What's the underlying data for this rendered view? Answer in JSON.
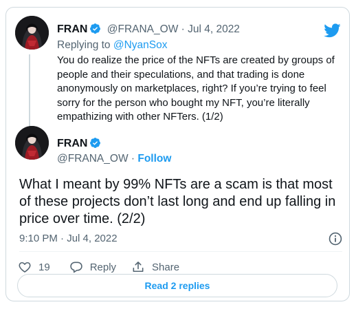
{
  "reply_tweet": {
    "name": "FRAN",
    "handle_date": "@FRANA_OW · Jul 4, 2022",
    "replying_prefix": "Replying to ",
    "replying_handle": "@NyanSox",
    "text": "You do realize the price of the NFTs are created by groups of people and their speculations, and that trading is done anonymously on marketplaces, right? If you’re trying to feel sorry for the person who bought my NFT, you’re literally empathizing with other NFTers. (1/2)"
  },
  "main_tweet": {
    "name": "FRAN",
    "handle": "@FRANA_OW",
    "separator": " · ",
    "follow_label": "Follow",
    "text": "What I meant by 99% NFTs are a scam is that most of these projects don’t last long and end up falling in price over time. (2/2)",
    "timestamp": "9:10 PM · Jul 4, 2022"
  },
  "actions": {
    "like_count": "19",
    "reply_label": "Reply",
    "share_label": "Share"
  },
  "read_replies_label": "Read 2 replies",
  "icons": {
    "logo": "twitter-bird-icon",
    "verified": "verified-badge-icon",
    "info": "info-icon",
    "like": "heart-icon",
    "reply": "speech-bubble-icon",
    "share": "share-upload-icon"
  },
  "colors": {
    "accent": "#1d9bf0",
    "text": "#0f1419",
    "muted": "#536471",
    "border": "#cfd9de"
  }
}
